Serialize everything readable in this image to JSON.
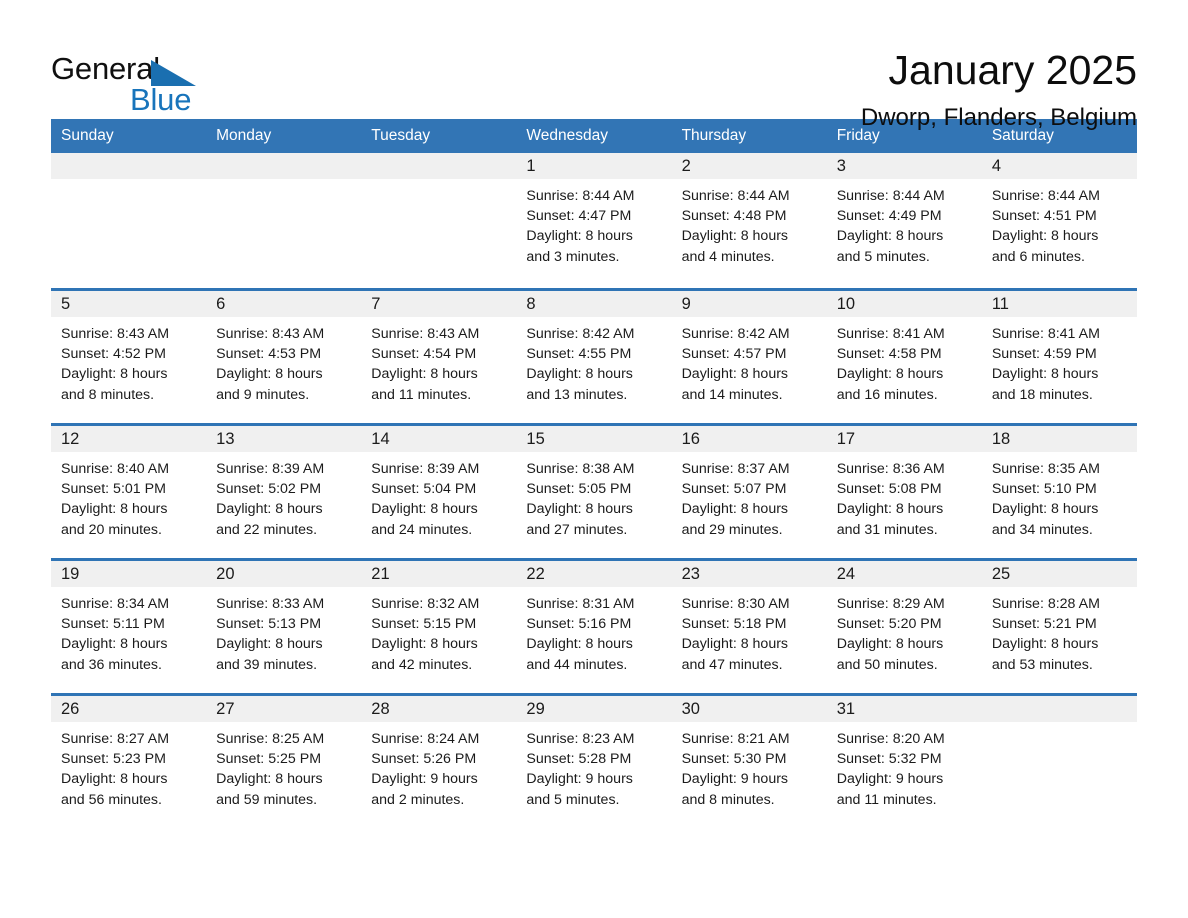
{
  "brand": {
    "name_part1": "General",
    "name_part2": "Blue",
    "triangle_color": "#1a6fb0",
    "blue_color": "#1874bb"
  },
  "header": {
    "title": "January 2025",
    "subtitle": "Dworp, Flanders, Belgium"
  },
  "theme": {
    "header_blue": "#3275b5",
    "divider_blue": "#2f74b5",
    "daynum_bg": "#f0f0f0",
    "text": "#1b1b1b"
  },
  "weekdays": [
    "Sunday",
    "Monday",
    "Tuesday",
    "Wednesday",
    "Thursday",
    "Friday",
    "Saturday"
  ],
  "weeks": [
    [
      {
        "day": "",
        "sunrise": "",
        "sunset": "",
        "daylight1": "",
        "daylight2": ""
      },
      {
        "day": "",
        "sunrise": "",
        "sunset": "",
        "daylight1": "",
        "daylight2": ""
      },
      {
        "day": "",
        "sunrise": "",
        "sunset": "",
        "daylight1": "",
        "daylight2": ""
      },
      {
        "day": "1",
        "sunrise": "Sunrise: 8:44 AM",
        "sunset": "Sunset: 4:47 PM",
        "daylight1": "Daylight: 8 hours",
        "daylight2": "and 3 minutes."
      },
      {
        "day": "2",
        "sunrise": "Sunrise: 8:44 AM",
        "sunset": "Sunset: 4:48 PM",
        "daylight1": "Daylight: 8 hours",
        "daylight2": "and 4 minutes."
      },
      {
        "day": "3",
        "sunrise": "Sunrise: 8:44 AM",
        "sunset": "Sunset: 4:49 PM",
        "daylight1": "Daylight: 8 hours",
        "daylight2": "and 5 minutes."
      },
      {
        "day": "4",
        "sunrise": "Sunrise: 8:44 AM",
        "sunset": "Sunset: 4:51 PM",
        "daylight1": "Daylight: 8 hours",
        "daylight2": "and 6 minutes."
      }
    ],
    [
      {
        "day": "5",
        "sunrise": "Sunrise: 8:43 AM",
        "sunset": "Sunset: 4:52 PM",
        "daylight1": "Daylight: 8 hours",
        "daylight2": "and 8 minutes."
      },
      {
        "day": "6",
        "sunrise": "Sunrise: 8:43 AM",
        "sunset": "Sunset: 4:53 PM",
        "daylight1": "Daylight: 8 hours",
        "daylight2": "and 9 minutes."
      },
      {
        "day": "7",
        "sunrise": "Sunrise: 8:43 AM",
        "sunset": "Sunset: 4:54 PM",
        "daylight1": "Daylight: 8 hours",
        "daylight2": "and 11 minutes."
      },
      {
        "day": "8",
        "sunrise": "Sunrise: 8:42 AM",
        "sunset": "Sunset: 4:55 PM",
        "daylight1": "Daylight: 8 hours",
        "daylight2": "and 13 minutes."
      },
      {
        "day": "9",
        "sunrise": "Sunrise: 8:42 AM",
        "sunset": "Sunset: 4:57 PM",
        "daylight1": "Daylight: 8 hours",
        "daylight2": "and 14 minutes."
      },
      {
        "day": "10",
        "sunrise": "Sunrise: 8:41 AM",
        "sunset": "Sunset: 4:58 PM",
        "daylight1": "Daylight: 8 hours",
        "daylight2": "and 16 minutes."
      },
      {
        "day": "11",
        "sunrise": "Sunrise: 8:41 AM",
        "sunset": "Sunset: 4:59 PM",
        "daylight1": "Daylight: 8 hours",
        "daylight2": "and 18 minutes."
      }
    ],
    [
      {
        "day": "12",
        "sunrise": "Sunrise: 8:40 AM",
        "sunset": "Sunset: 5:01 PM",
        "daylight1": "Daylight: 8 hours",
        "daylight2": "and 20 minutes."
      },
      {
        "day": "13",
        "sunrise": "Sunrise: 8:39 AM",
        "sunset": "Sunset: 5:02 PM",
        "daylight1": "Daylight: 8 hours",
        "daylight2": "and 22 minutes."
      },
      {
        "day": "14",
        "sunrise": "Sunrise: 8:39 AM",
        "sunset": "Sunset: 5:04 PM",
        "daylight1": "Daylight: 8 hours",
        "daylight2": "and 24 minutes."
      },
      {
        "day": "15",
        "sunrise": "Sunrise: 8:38 AM",
        "sunset": "Sunset: 5:05 PM",
        "daylight1": "Daylight: 8 hours",
        "daylight2": "and 27 minutes."
      },
      {
        "day": "16",
        "sunrise": "Sunrise: 8:37 AM",
        "sunset": "Sunset: 5:07 PM",
        "daylight1": "Daylight: 8 hours",
        "daylight2": "and 29 minutes."
      },
      {
        "day": "17",
        "sunrise": "Sunrise: 8:36 AM",
        "sunset": "Sunset: 5:08 PM",
        "daylight1": "Daylight: 8 hours",
        "daylight2": "and 31 minutes."
      },
      {
        "day": "18",
        "sunrise": "Sunrise: 8:35 AM",
        "sunset": "Sunset: 5:10 PM",
        "daylight1": "Daylight: 8 hours",
        "daylight2": "and 34 minutes."
      }
    ],
    [
      {
        "day": "19",
        "sunrise": "Sunrise: 8:34 AM",
        "sunset": "Sunset: 5:11 PM",
        "daylight1": "Daylight: 8 hours",
        "daylight2": "and 36 minutes."
      },
      {
        "day": "20",
        "sunrise": "Sunrise: 8:33 AM",
        "sunset": "Sunset: 5:13 PM",
        "daylight1": "Daylight: 8 hours",
        "daylight2": "and 39 minutes."
      },
      {
        "day": "21",
        "sunrise": "Sunrise: 8:32 AM",
        "sunset": "Sunset: 5:15 PM",
        "daylight1": "Daylight: 8 hours",
        "daylight2": "and 42 minutes."
      },
      {
        "day": "22",
        "sunrise": "Sunrise: 8:31 AM",
        "sunset": "Sunset: 5:16 PM",
        "daylight1": "Daylight: 8 hours",
        "daylight2": "and 44 minutes."
      },
      {
        "day": "23",
        "sunrise": "Sunrise: 8:30 AM",
        "sunset": "Sunset: 5:18 PM",
        "daylight1": "Daylight: 8 hours",
        "daylight2": "and 47 minutes."
      },
      {
        "day": "24",
        "sunrise": "Sunrise: 8:29 AM",
        "sunset": "Sunset: 5:20 PM",
        "daylight1": "Daylight: 8 hours",
        "daylight2": "and 50 minutes."
      },
      {
        "day": "25",
        "sunrise": "Sunrise: 8:28 AM",
        "sunset": "Sunset: 5:21 PM",
        "daylight1": "Daylight: 8 hours",
        "daylight2": "and 53 minutes."
      }
    ],
    [
      {
        "day": "26",
        "sunrise": "Sunrise: 8:27 AM",
        "sunset": "Sunset: 5:23 PM",
        "daylight1": "Daylight: 8 hours",
        "daylight2": "and 56 minutes."
      },
      {
        "day": "27",
        "sunrise": "Sunrise: 8:25 AM",
        "sunset": "Sunset: 5:25 PM",
        "daylight1": "Daylight: 8 hours",
        "daylight2": "and 59 minutes."
      },
      {
        "day": "28",
        "sunrise": "Sunrise: 8:24 AM",
        "sunset": "Sunset: 5:26 PM",
        "daylight1": "Daylight: 9 hours",
        "daylight2": "and 2 minutes."
      },
      {
        "day": "29",
        "sunrise": "Sunrise: 8:23 AM",
        "sunset": "Sunset: 5:28 PM",
        "daylight1": "Daylight: 9 hours",
        "daylight2": "and 5 minutes."
      },
      {
        "day": "30",
        "sunrise": "Sunrise: 8:21 AM",
        "sunset": "Sunset: 5:30 PM",
        "daylight1": "Daylight: 9 hours",
        "daylight2": "and 8 minutes."
      },
      {
        "day": "31",
        "sunrise": "Sunrise: 8:20 AM",
        "sunset": "Sunset: 5:32 PM",
        "daylight1": "Daylight: 9 hours",
        "daylight2": "and 11 minutes."
      },
      {
        "day": "",
        "sunrise": "",
        "sunset": "",
        "daylight1": "",
        "daylight2": ""
      }
    ]
  ]
}
